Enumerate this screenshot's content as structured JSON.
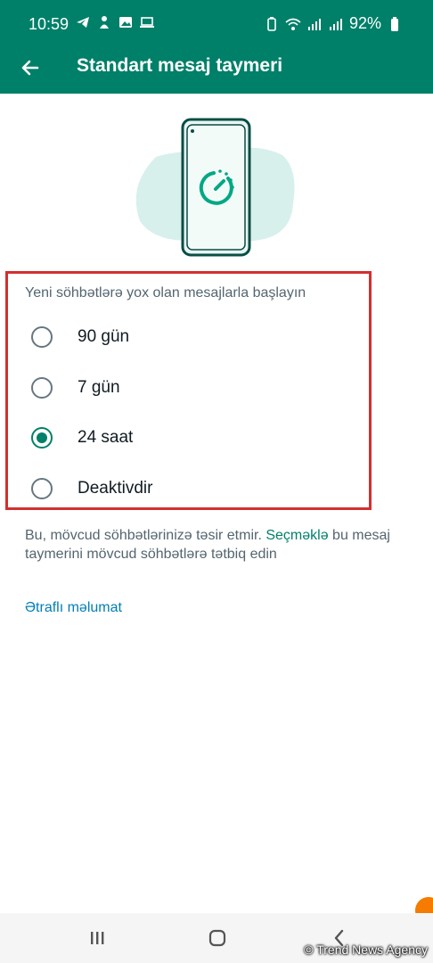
{
  "status_bar": {
    "time": "10:59",
    "battery_percent": "92%",
    "left_icons": [
      "telegram-icon",
      "hand-icon",
      "gallery-icon",
      "laptop-icon"
    ],
    "right_icons": [
      "battery-saver-icon",
      "wifi-icon",
      "signal-icon",
      "signal-icon",
      "battery-icon"
    ]
  },
  "toolbar": {
    "back_icon": "arrow-left-icon",
    "title": "Standart mesaj taymeri"
  },
  "colors": {
    "brand": "#008069",
    "accent_light": "#d7f0ec",
    "link": "#027eb5",
    "highlight_frame": "#d32f2f"
  },
  "options": {
    "heading": "Yeni söhbətlərə yox olan mesajlarla başlayın",
    "items": [
      {
        "label": "90 gün",
        "selected": false
      },
      {
        "label": "7 gün",
        "selected": false
      },
      {
        "label": "24 saat",
        "selected": true
      },
      {
        "label": "Deaktivdir",
        "selected": false
      }
    ]
  },
  "info": {
    "text_before": "Bu, mövcud söhbətlərinizə təsir etmir. ",
    "link": "Seçməklə",
    "text_after": " bu mesaj taymerini mövcud söhbətlərə tətbiq edin"
  },
  "learn_more": "Ətraflı məlumat",
  "navbar": {
    "icons": [
      "recent-apps-icon",
      "home-icon",
      "back-icon"
    ]
  },
  "watermark": "© Trend News Agency"
}
